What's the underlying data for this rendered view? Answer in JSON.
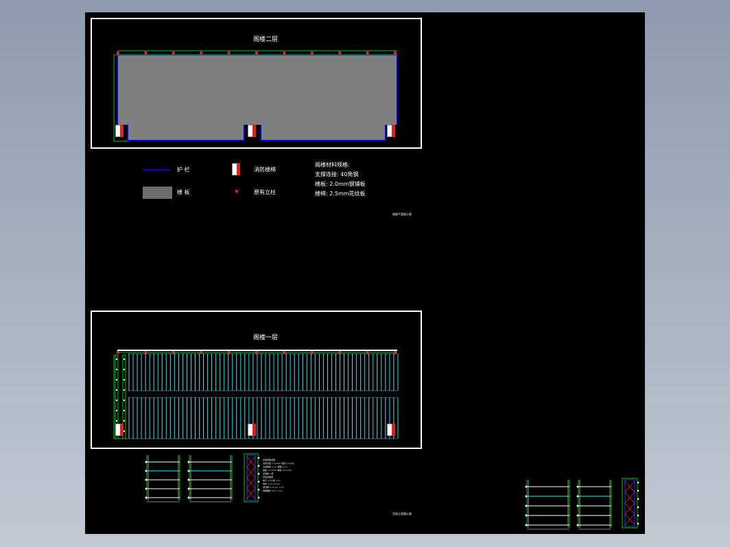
{
  "plan_upper": {
    "title": "阁楼二层"
  },
  "plan_lower": {
    "title": "阁楼一层"
  },
  "legend": {
    "guardrail": "护 栏",
    "stairs": "消防楼梯",
    "floor_board": "楼 板",
    "column": "原有立柱"
  },
  "materials": {
    "heading": "阁楼材料规格:",
    "lines": [
      "支撑连接: 40角钢",
      "楼板: 2.0mm钢铺板",
      "楼梯: 2.5mm花纹板"
    ]
  },
  "sheet_note": "阁楼平面图示意",
  "sheet_note_2": "货架立面图示意",
  "detail_notes": [
    "货架参数说明",
    "货架高度 ×××mm 层载 ×××kg",
    "立柱规格 ×××  横梁 ×××",
    "层板 ×××mm 跨度 ×××mm",
    "总层数 ×层",
    "货架总数量",
    "单元 ×××组  ×××",
    "附件 ××× ××××",
    "调节脚 ××××× ×××",
    "地脚螺栓 ××× ×××"
  ],
  "colors": {
    "background": "#000000",
    "floor": "#7f7f7f",
    "guardrail": "#0000dd",
    "column": "#e02020",
    "outline": "#00c800",
    "rack": "#00ffff"
  }
}
